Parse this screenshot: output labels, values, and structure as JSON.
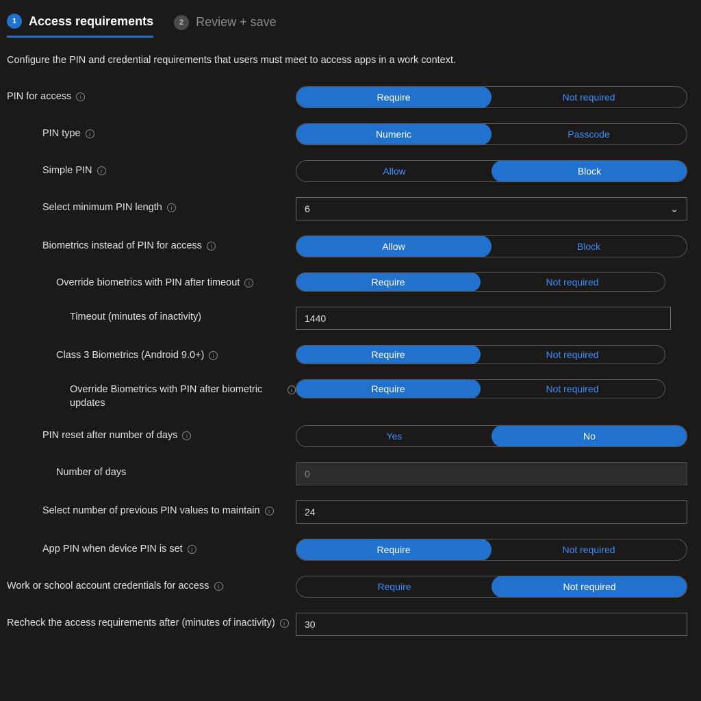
{
  "tabs": {
    "step1_label": "Access requirements",
    "step2_label": "Review + save"
  },
  "description": "Configure the PIN and credential requirements that users must meet to access apps in a work context.",
  "labels": {
    "pin_access": "PIN for access",
    "pin_type": "PIN type",
    "simple_pin": "Simple PIN",
    "min_pin_length": "Select minimum PIN length",
    "biometrics": "Biometrics instead of PIN for access",
    "override_bio_timeout": "Override biometrics with PIN after timeout",
    "timeout": "Timeout (minutes of inactivity)",
    "class3": "Class 3 Biometrics (Android 9.0+)",
    "override_bio_updates": "Override Biometrics with PIN after biometric updates",
    "pin_reset": "PIN reset after number of days",
    "number_days": "Number of days",
    "previous_pins": "Select number of previous PIN values to maintain",
    "app_pin_device": "App PIN when device PIN is set",
    "work_creds": "Work or school account credentials for access",
    "recheck": "Recheck the access requirements after (minutes of inactivity)"
  },
  "opts": {
    "require": "Require",
    "not_required": "Not required",
    "numeric": "Numeric",
    "passcode": "Passcode",
    "allow": "Allow",
    "block": "Block",
    "yes": "Yes",
    "no": "No"
  },
  "values": {
    "min_pin_length": "6",
    "timeout": "1440",
    "number_days": "0",
    "previous_pins": "24",
    "recheck": "30"
  }
}
